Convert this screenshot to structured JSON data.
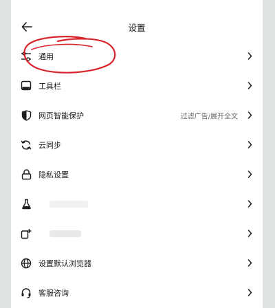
{
  "header": {
    "title": "设置"
  },
  "menu": {
    "items": [
      {
        "label": "通用",
        "value": "",
        "icon": "sliders-icon"
      },
      {
        "label": "工具栏",
        "value": "",
        "icon": "toolbar-icon"
      },
      {
        "label": "网页智能保护",
        "value": "过滤广告/展开全文",
        "icon": "shield-icon"
      },
      {
        "label": "云同步",
        "value": "",
        "icon": "sync-icon"
      },
      {
        "label": "隐私设置",
        "value": "",
        "icon": "lock-icon"
      },
      {
        "label": "",
        "value": "",
        "icon": "flask-icon"
      },
      {
        "label": "",
        "value": "",
        "icon": "app-add-icon"
      },
      {
        "label": "设置默认浏览器",
        "value": "",
        "icon": "globe-icon"
      },
      {
        "label": "客服咨询",
        "value": "",
        "icon": "headset-icon"
      }
    ]
  },
  "colors": {
    "background": "#dfe4e0",
    "panel": "#ffffff",
    "text": "#1a1a1a",
    "secondary_text": "#666666",
    "annotation": "#d8232a"
  }
}
